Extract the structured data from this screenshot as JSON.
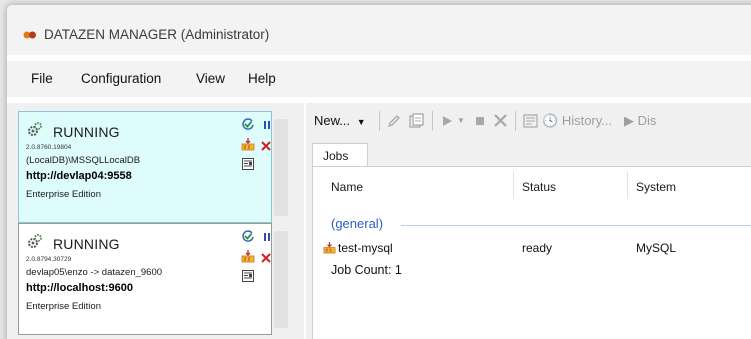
{
  "window": {
    "title": "DATAZEN MANAGER (Administrator)"
  },
  "menu": [
    "File",
    "Configuration",
    "View",
    "Help"
  ],
  "servers": [
    {
      "status": "RUNNING",
      "version": "2.0.8760.19804",
      "instance": "(LocalDB)\\MSSQLLocalDB",
      "url": "http://devlap04:9558",
      "edition": "Enterprise Edition",
      "selected": true
    },
    {
      "status": "RUNNING",
      "version": "2.0.8794.30729",
      "instance": "devlap05\\enzo -> datazen_9600",
      "url": "http://localhost:9600",
      "edition": "Enterprise Edition",
      "selected": false
    }
  ],
  "toolbar": {
    "new_label": "New...",
    "history_label": "History...",
    "dis_label": "Dis"
  },
  "tabs": [
    "Jobs"
  ],
  "jobs_list": {
    "columns": [
      "Name",
      "Status",
      "System"
    ],
    "group": "(general)",
    "rows": [
      {
        "name": "test-mysql",
        "status": "ready",
        "system": "MySQL"
      }
    ],
    "count_text": "Job Count: 1"
  },
  "colors": {
    "selected_card": "#dffcfd",
    "group_text": "#2f5fbf",
    "stop_red": "#d42020",
    "pause_blue": "#2b4fa8",
    "check_green": "#2e8b3a"
  },
  "icons": [
    "app-logo-icon",
    "server-gear-icon",
    "refresh-check-icon",
    "pause-icon",
    "import-jobs-icon",
    "stop-x-icon",
    "console-icon",
    "pencil-icon",
    "copy-icon",
    "run-icon",
    "stop-icon",
    "delete-icon",
    "history-icon",
    "job-icon"
  ]
}
